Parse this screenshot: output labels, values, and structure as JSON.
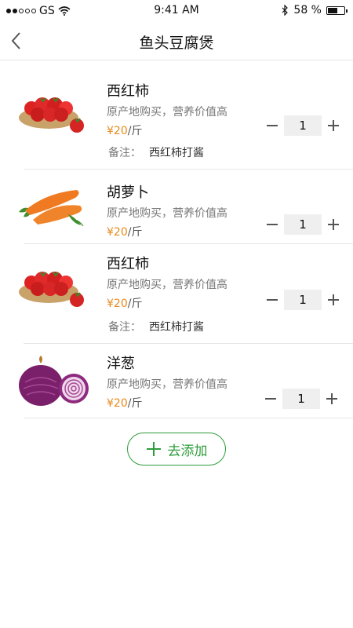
{
  "status": {
    "carrier": "GS",
    "time": "9:41 AM",
    "battery": "58 %",
    "battery_level": 0.58
  },
  "nav": {
    "title": "鱼头豆腐煲"
  },
  "items": [
    {
      "name": "西红柿",
      "desc": "原产地购买，营养价值高",
      "price_amount": "¥20",
      "price_unit": "/斤",
      "qty": "1",
      "note_label": "备注：",
      "note_value": "西红柿打酱",
      "image": "tomato"
    },
    {
      "name": "胡萝卜",
      "desc": "原产地购买，营养价值高",
      "price_amount": "¥20",
      "price_unit": "/斤",
      "qty": "1",
      "image": "carrot"
    },
    {
      "name": "西红柿",
      "desc": "原产地购买，营养价值高",
      "price_amount": "¥20",
      "price_unit": "/斤",
      "qty": "1",
      "note_label": "备注：",
      "note_value": "西红柿打酱",
      "image": "tomato"
    },
    {
      "name": "洋葱",
      "desc": "原产地购买，营养价值高",
      "price_amount": "¥20",
      "price_unit": "/斤",
      "qty": "1",
      "image": "onion"
    }
  ],
  "add_button": {
    "label": "去添加"
  },
  "colors": {
    "accent_green": "#2e9c3a",
    "price_orange": "#e88a1a"
  }
}
